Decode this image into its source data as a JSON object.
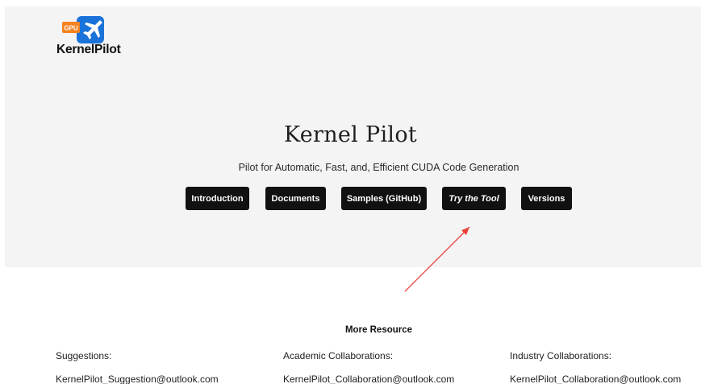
{
  "brand": {
    "badge_text": "GPU",
    "logo_text": "KernelPilot",
    "colors": {
      "badge_orange": "#f5821f",
      "plane_blue": "#1a73d9"
    }
  },
  "hero": {
    "title": "Kernel Pilot",
    "subtitle": "Pilot for Automatic, Fast, and, Efficient CUDA Code Generation",
    "background": "#f4f4f4"
  },
  "nav_buttons": [
    {
      "label": "Introduction"
    },
    {
      "label": "Documents"
    },
    {
      "label": "Samples (GitHub)"
    },
    {
      "label": "Try the Tool"
    },
    {
      "label": "Versions"
    }
  ],
  "annotation": {
    "arrow_color": "#e8413a",
    "icon": "red-arrow-pointing-to-try-the-tool"
  },
  "resources": {
    "title": "More Resource",
    "columns": [
      {
        "label": "Suggestions:",
        "email": "KernelPilot_Suggestion@outlook.com"
      },
      {
        "label": "Academic Collaborations:",
        "email": "KernelPilot_Collaboration@outlook.com"
      },
      {
        "label": "Industry Collaborations:",
        "email": "KernelPilot_Collaboration@outlook.com"
      }
    ]
  }
}
